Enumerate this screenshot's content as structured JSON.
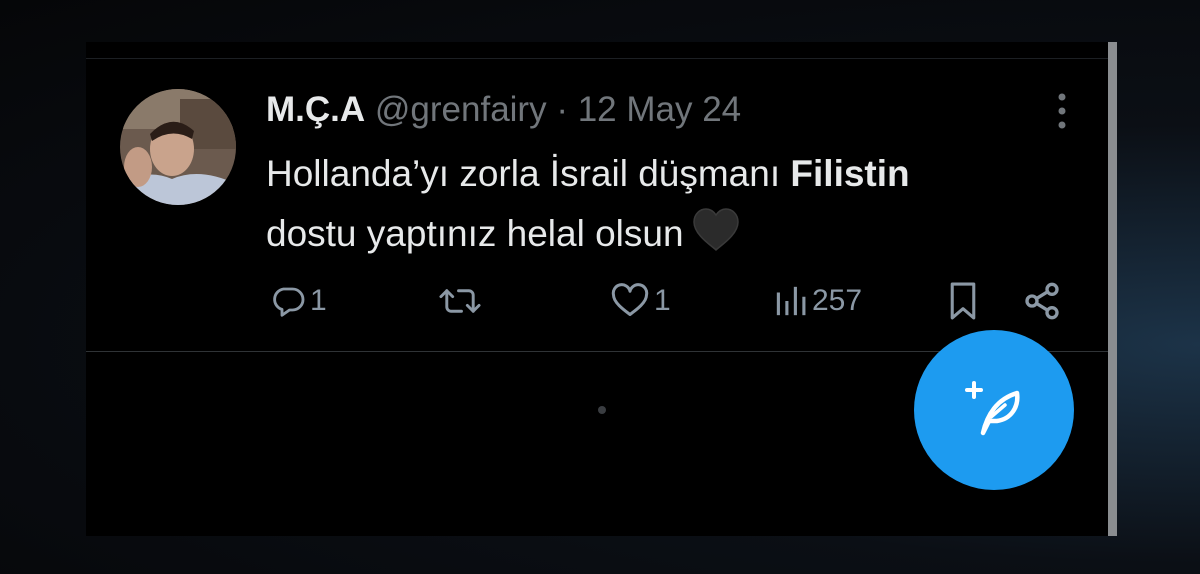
{
  "tweet": {
    "display_name": "M.Ç.A",
    "handle": "@grenfairy",
    "separator": "·",
    "date": "12 May 24",
    "text_part1": "Hollanda’yı zorla İsrail düşmanı ",
    "text_bold": "Filistin",
    "text_part2": "dostu yaptınız helal olsun",
    "emoji": "black-heart"
  },
  "actions": {
    "reply_count": "1",
    "like_count": "1",
    "views_count": "257"
  },
  "icons": [
    "more-vertical-icon",
    "reply-icon",
    "retweet-icon",
    "like-icon",
    "views-icon",
    "bookmark-icon",
    "share-icon",
    "compose-icon"
  ],
  "colors": {
    "accent": "#1d9bf0",
    "text": "#e7e9ea",
    "muted": "#71767b",
    "background": "#000000"
  }
}
